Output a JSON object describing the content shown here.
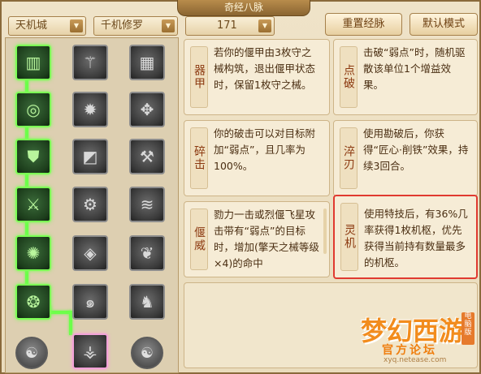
{
  "window": {
    "title": "奇经八脉"
  },
  "filters": {
    "school": "天机城",
    "branch": "千机修罗",
    "points": "171"
  },
  "toolbar": {
    "reset_label": "重置经脉",
    "default_label": "默认模式"
  },
  "skill_tree": {
    "columns": [
      [
        {
          "icon": "book-icon",
          "active": true
        },
        {
          "icon": "target-rings-icon",
          "active": true
        },
        {
          "icon": "broken-shield-icon",
          "active": true
        },
        {
          "icon": "crossed-weapons-icon",
          "active": true
        },
        {
          "icon": "rune-circle-icon",
          "active": true
        },
        {
          "icon": "swirl-orb-icon",
          "active": true
        }
      ],
      [
        {
          "icon": "broken-blade-icon",
          "active": false
        },
        {
          "icon": "flame-burst-icon",
          "active": false
        },
        {
          "icon": "cube-glyph-icon",
          "active": false
        },
        {
          "icon": "gear-gem-icon",
          "active": false
        },
        {
          "icon": "diamond-sigil-icon",
          "active": false
        },
        {
          "icon": "spiral-icon",
          "active": false
        },
        {
          "icon": "blade-trident-icon",
          "active": false,
          "selected": true
        }
      ],
      [
        {
          "icon": "puzzle-tablet-icon",
          "active": false
        },
        {
          "icon": "beast-claw-icon",
          "active": false
        },
        {
          "icon": "anvil-icon",
          "active": false
        },
        {
          "icon": "wind-slash-icon",
          "active": false
        },
        {
          "icon": "lotus-mask-icon",
          "active": false
        },
        {
          "icon": "mech-figure-icon",
          "active": false
        }
      ]
    ],
    "round_buttons": [
      "serpent-emblem-icon",
      "serpent-emblem-icon"
    ]
  },
  "cards": [
    {
      "name": "器甲",
      "desc": "若你的偃甲由3枚守之械构筑，退出偃甲状态时，保留1枚守之械。"
    },
    {
      "name": "点破",
      "desc": "击破“弱点”时，随机驱散该单位1个增益效果。"
    },
    {
      "name": "碎击",
      "desc": "你的破击可以对目标附加“弱点”，且几率为100%。"
    },
    {
      "name": "淬刃",
      "desc": "使用勘破后，你获得“匠心·削铁”效果，持续3回合。"
    },
    {
      "name": "偃威",
      "desc": "勠力一击或烈偃飞星攻击带有“弱点”的目标时，增加(擎天之械等级×4)的命中"
    },
    {
      "name": "灵机",
      "desc": "使用特技后，有36%几率获得1枚机枢，优先获得当前持有数量最多的机枢。"
    }
  ],
  "logo": {
    "big": "梦幻西游",
    "sub": "官方论坛",
    "url": "xyq.netease.com",
    "tag": "电脑版"
  },
  "colors": {
    "accent": "#8c3a11",
    "active_glow": "#7cff55",
    "highlight_border": "#e03a30"
  }
}
